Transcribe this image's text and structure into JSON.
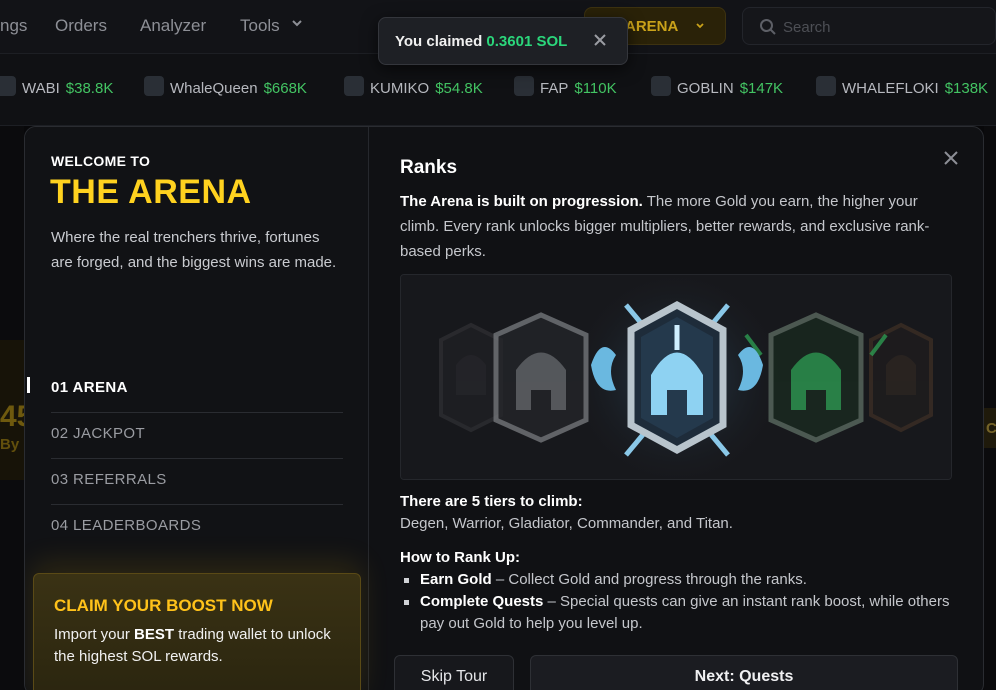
{
  "nav": {
    "items": [
      "ngs",
      "Orders",
      "Analyzer",
      "Tools"
    ],
    "arena_label": "ARENA",
    "search_placeholder": "Search"
  },
  "toast": {
    "prefix": "You claimed ",
    "amount": "0.3601 SOL"
  },
  "ticker": [
    {
      "name": "WABI",
      "value": "$38.8K"
    },
    {
      "name": "WhaleQueen",
      "value": "$668K"
    },
    {
      "name": "KUMIKO",
      "value": "$54.8K"
    },
    {
      "name": "FAP",
      "value": "$110K"
    },
    {
      "name": "GOBLIN",
      "value": "$147K"
    },
    {
      "name": "WHALEFLOKI",
      "value": "$138K"
    }
  ],
  "background": {
    "big_number": "45",
    "by_text": "By I",
    "right_chip": "C"
  },
  "modal": {
    "welcome": "WELCOME TO",
    "title": "THE ARENA",
    "tagline": "Where the real trenchers thrive, fortunes are forged, and the biggest wins are made.",
    "steps": [
      {
        "label": "01  ARENA"
      },
      {
        "label": "02  JACKPOT"
      },
      {
        "label": "03  REFERRALS"
      },
      {
        "label": "04  LEADERBOARDS"
      }
    ],
    "boost": {
      "heading": "CLAIM YOUR BOOST NOW",
      "text_a": "Import your ",
      "text_b": "BEST",
      "text_c": " trading wallet to unlock the highest SOL rewards."
    },
    "ranks": {
      "title": "Ranks",
      "intro_bold": "The Arena is built on progression.",
      "intro_rest": " The more Gold you earn, the higher your climb. Every rank unlocks bigger multipliers, better rewards, and exclusive rank-based perks.",
      "tiers_heading": "There are 5 tiers to climb:",
      "tiers_list": "Degen, Warrior, Gladiator, Commander, and Titan.",
      "howto_heading": "How to Rank Up:",
      "howto_items": [
        {
          "bold": "Earn Gold",
          "rest": " – Collect Gold and progress through the ranks."
        },
        {
          "bold": "Complete Quests",
          "rest": " – Special quests can give an instant rank boost, while others pay out Gold to help you level up."
        }
      ]
    },
    "buttons": {
      "skip": "Skip Tour",
      "next": "Next: Quests"
    }
  },
  "colors": {
    "accent_gold": "#ffd21f",
    "positive_green": "#43c463",
    "toast_green": "#2bd67b"
  }
}
